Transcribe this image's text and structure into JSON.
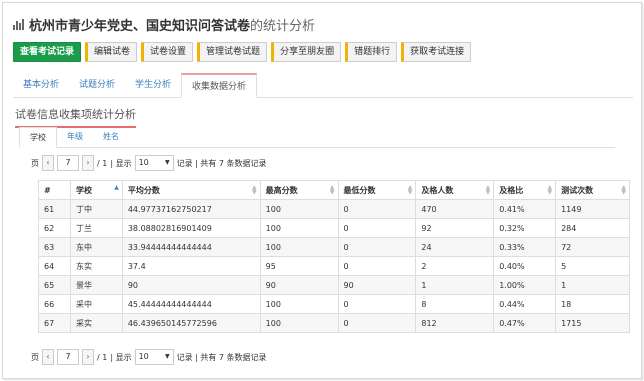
{
  "title": {
    "bold": "杭州市青少年党史、国史知识问答试卷",
    "rest": "的统计分析"
  },
  "toolbar": {
    "buttons": [
      "查看考试记录",
      "编辑试卷",
      "试卷设置",
      "管理试卷试题",
      "分享至朋友圈",
      "错题排行",
      "获取考试连接"
    ]
  },
  "tabs": [
    "基本分析",
    "试题分析",
    "学生分析",
    "收集数据分析"
  ],
  "panel": {
    "title": "试卷信息收集项统计分析"
  },
  "subtabs": [
    "学校",
    "年级",
    "姓名"
  ],
  "pager": {
    "page_label": "页",
    "prev": "‹",
    "next": "›",
    "page": "7",
    "total": "/ 1",
    "show_label": "| 显示",
    "page_size": "10",
    "records_label": "记录 | 共有 7 条数据记录"
  },
  "table": {
    "headers": [
      "#",
      "学校",
      "平均分数",
      "最高分数",
      "最低分数",
      "及格人数",
      "及格比",
      "测试次数"
    ],
    "rows": [
      [
        "61",
        "丁中",
        "44.97737162750217",
        "100",
        "0",
        "470",
        "0.41%",
        "1149"
      ],
      [
        "62",
        "丁兰",
        "38.08802816901409",
        "100",
        "0",
        "92",
        "0.32%",
        "284"
      ],
      [
        "63",
        "东中",
        "33.94444444444444",
        "100",
        "0",
        "24",
        "0.33%",
        "72"
      ],
      [
        "64",
        "东实",
        "37.4",
        "95",
        "0",
        "2",
        "0.40%",
        "5"
      ],
      [
        "65",
        "景华",
        "90",
        "90",
        "90",
        "1",
        "1.00%",
        "1"
      ],
      [
        "66",
        "采中",
        "45.44444444444444",
        "100",
        "0",
        "8",
        "0.44%",
        "18"
      ],
      [
        "67",
        "采实",
        "46.439650145772596",
        "100",
        "0",
        "812",
        "0.47%",
        "1715"
      ]
    ]
  }
}
